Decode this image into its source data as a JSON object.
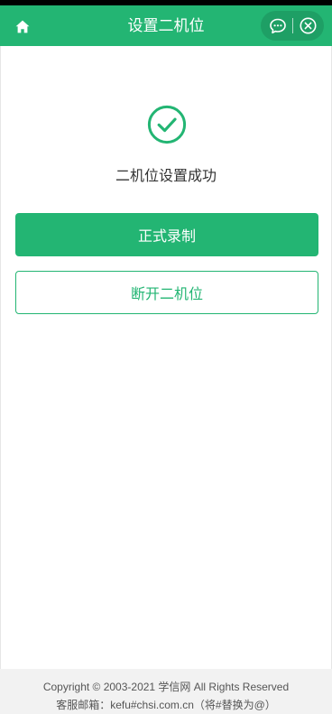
{
  "header": {
    "title": "设置二机位",
    "home_icon": "home-icon",
    "chat_icon": "chat-bubble-icon",
    "close_icon": "close-circle-icon",
    "background_color": "#23b573"
  },
  "main": {
    "success_icon": "check-circle-icon",
    "success_message": "二机位设置成功",
    "primary_button_label": "正式录制",
    "secondary_button_label": "断开二机位",
    "accent_color": "#23b573"
  },
  "footer": {
    "copyright": "Copyright © 2003-2021 学信网 All Rights Reserved",
    "contact": "客服邮箱：kefu#chsi.com.cn（将#替换为@）"
  }
}
